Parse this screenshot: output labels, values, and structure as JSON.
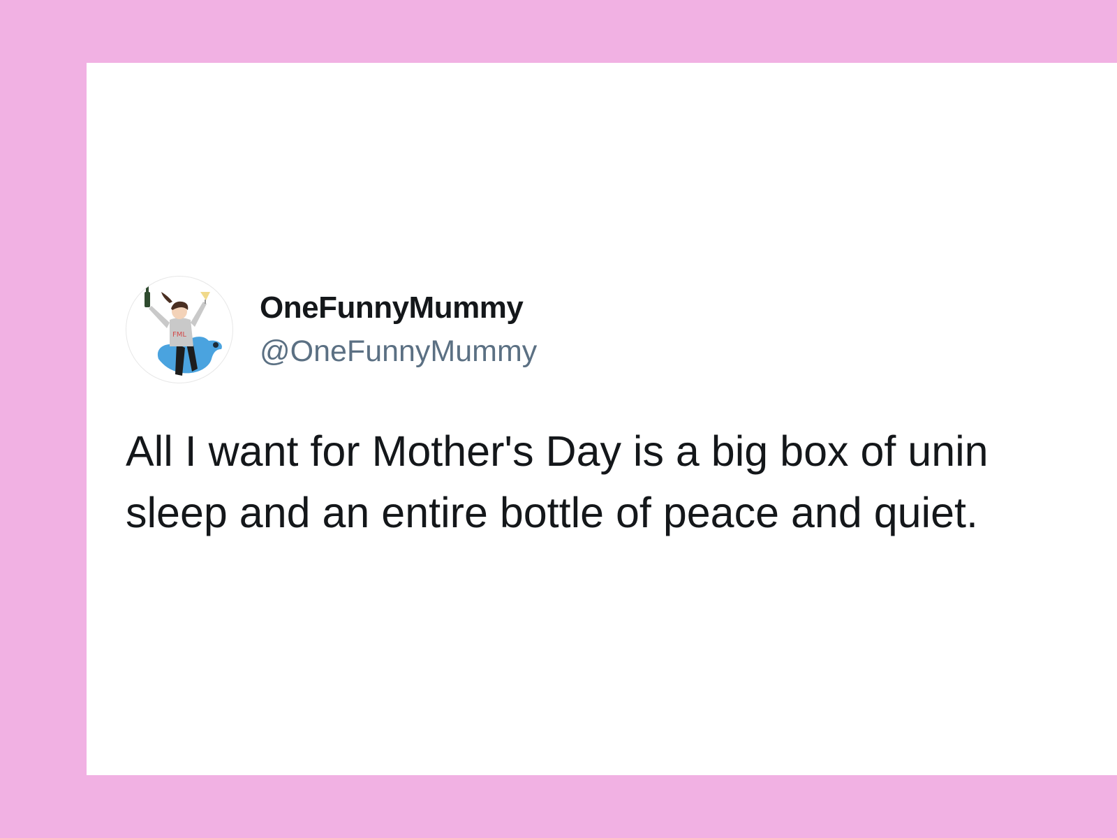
{
  "tweet": {
    "author": {
      "display_name": "OneFunnyMummy",
      "handle": "@OneFunnyMummy",
      "avatar_icon": "cartoon-mum-on-bird-avatar"
    },
    "text_lines": [
      "All I want for Mother's Day is a big box of unin",
      "sleep and an entire bottle of peace and quiet."
    ]
  },
  "colors": {
    "frame": "#f1b1e3",
    "card": "#ffffff",
    "name": "#14171a",
    "handle": "#5b7083",
    "bird": "#4aa3df"
  }
}
